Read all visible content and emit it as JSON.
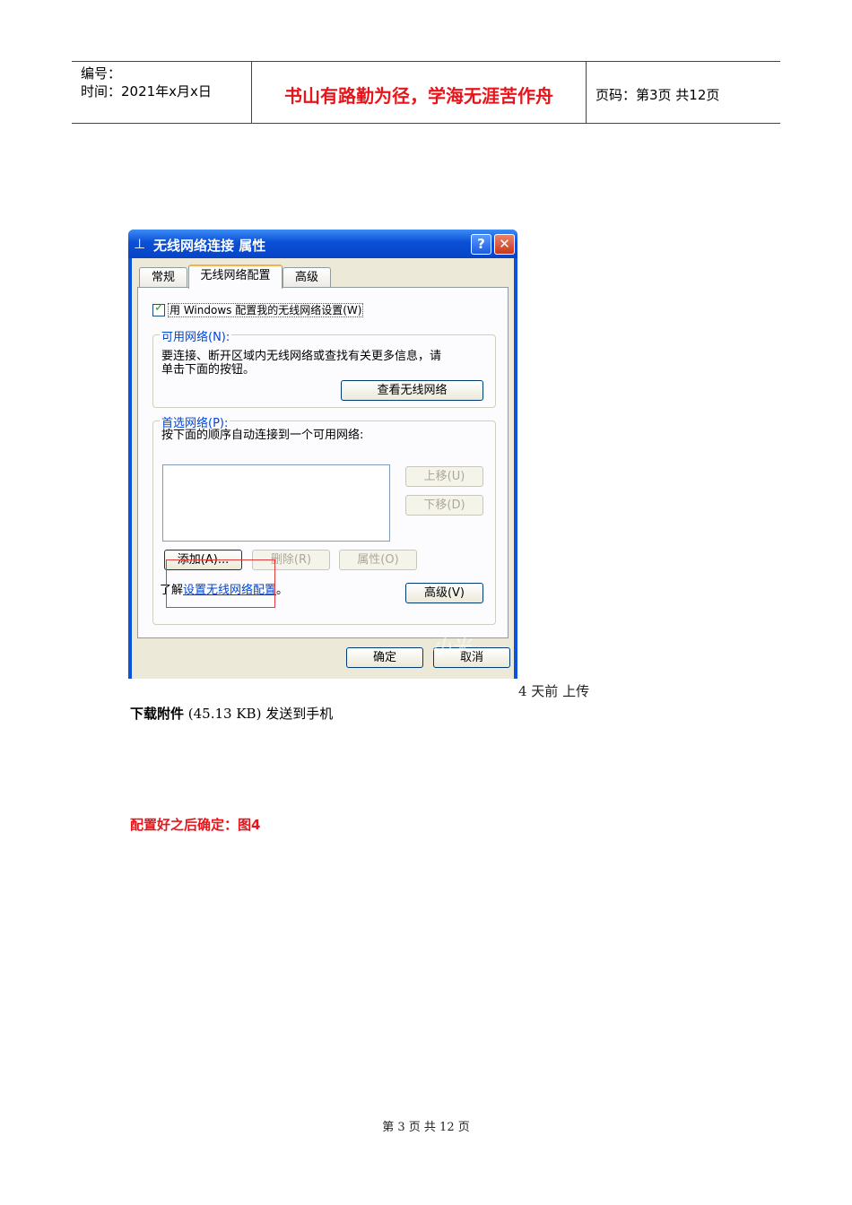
{
  "header": {
    "number_label": "编号：",
    "date_label": "时间：2021年x月x日",
    "motto": "书山有路勤为径，学海无涯苦作舟",
    "page_label": "页码：第3页 共12页"
  },
  "dialog": {
    "title": "无线网络连接 属性",
    "help_label": "?",
    "close_label": "✕",
    "tabs": [
      "常规",
      "无线网络配置",
      "高级"
    ],
    "use_windows_checkbox": "用 Windows 配置我的无线网络设置(W)",
    "available_networks": {
      "title": "可用网络(N):",
      "text_line1": "要连接、断开区域内无线网络或查找有关更多信息，请",
      "text_line2": "单击下面的按钮。",
      "view_button": "查看无线网络"
    },
    "preferred_networks": {
      "title": "首选网络(P):",
      "text": "按下面的顺序自动连接到一个可用网络:",
      "move_up": "上移(U)",
      "move_down": "下移(D)",
      "add": "添加(A)...",
      "remove": "删除(R)",
      "properties": "属性(O)",
      "learn_prefix": "了解",
      "learn_link": "设置无线网络配置",
      "learn_suffix": "。",
      "advanced": "高级(V)"
    },
    "ok": "确定",
    "cancel": "取消",
    "watermark": "小米"
  },
  "captions": {
    "upload": "4 天前 上传",
    "download_bold": "下载附件",
    "download_rest": " (45.13 KB) 发送到手机",
    "config": "配置好之后确定：图4"
  },
  "footer": "第 3 页 共 12 页"
}
